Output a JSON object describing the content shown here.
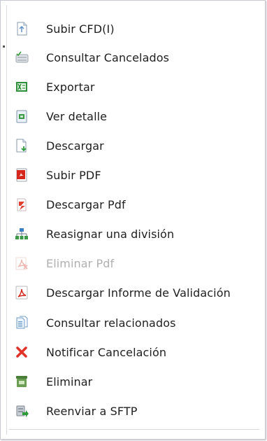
{
  "menu": {
    "items": [
      {
        "label": "Subir CFD(I)",
        "icon": "upload-document-icon",
        "enabled": true
      },
      {
        "label": "Consultar Cancelados",
        "icon": "cancelled-list-icon",
        "enabled": true
      },
      {
        "label": "Exportar",
        "icon": "excel-export-icon",
        "enabled": true
      },
      {
        "label": "Ver detalle",
        "icon": "view-detail-icon",
        "enabled": true
      },
      {
        "label": "Descargar",
        "icon": "download-document-icon",
        "enabled": true
      },
      {
        "label": "Subir PDF",
        "icon": "pdf-upload-icon",
        "enabled": true
      },
      {
        "label": "Descargar Pdf",
        "icon": "pdf-download-icon",
        "enabled": true
      },
      {
        "label": "Reasignar una división",
        "icon": "org-chart-icon",
        "enabled": true
      },
      {
        "label": "Eliminar Pdf",
        "icon": "pdf-delete-icon",
        "enabled": false
      },
      {
        "label": "Descargar Informe de Validación",
        "icon": "acrobat-pdf-icon",
        "enabled": true
      },
      {
        "label": "Consultar relacionados",
        "icon": "related-documents-icon",
        "enabled": true
      },
      {
        "label": "Notificar Cancelación",
        "icon": "red-x-icon",
        "enabled": true
      },
      {
        "label": "Eliminar",
        "icon": "trash-bin-icon",
        "enabled": true
      },
      {
        "label": "Reenviar a SFTP",
        "icon": "sftp-forward-icon",
        "enabled": true
      }
    ]
  },
  "colors": {
    "text": "#1f1f1f",
    "disabled_text": "#b0b0b0",
    "red_accent": "#d7261b",
    "green_accent": "#2f9a3a"
  }
}
